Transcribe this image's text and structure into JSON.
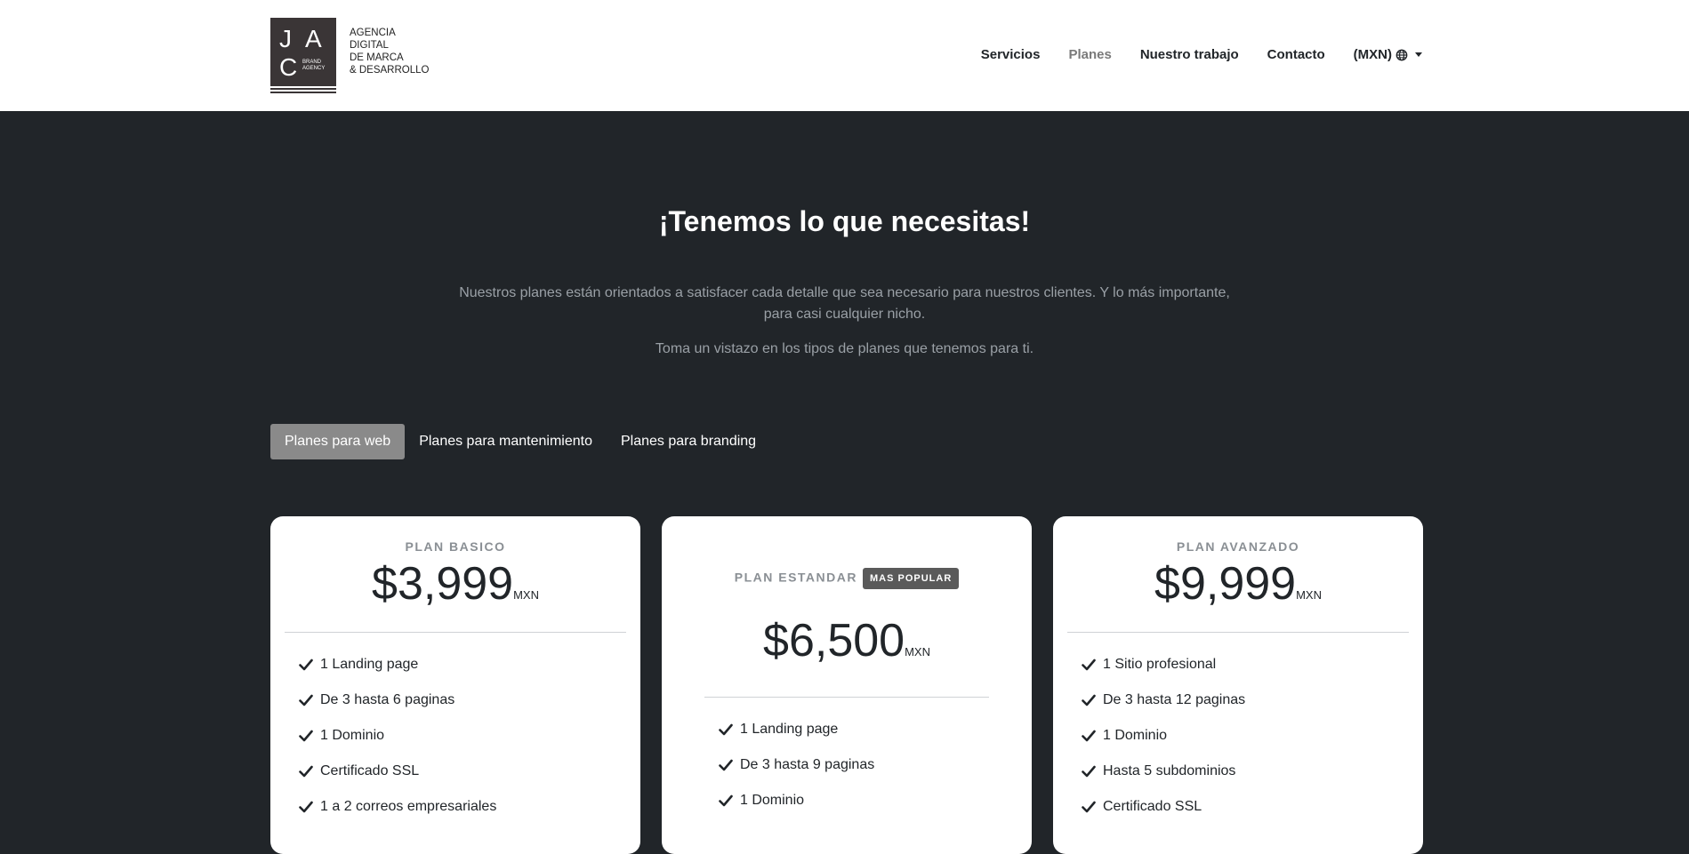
{
  "logo": {
    "letters": [
      "J",
      "A",
      "C"
    ],
    "small": "BRAND\nAGENCY",
    "text": "AGENCIA\nDIGITAL\nDE MARCA\n& DESARROLLO"
  },
  "nav": {
    "items": [
      {
        "label": "Servicios"
      },
      {
        "label": "Planes"
      },
      {
        "label": "Nuestro trabajo"
      },
      {
        "label": "Contacto"
      }
    ],
    "currency": "(MXN)",
    "icon": "globe-icon"
  },
  "hero": {
    "title": "¡Tenemos lo que necesitas!",
    "para1_line1": "Nuestros planes están orientados a satisfacer cada detalle que sea necesario para nuestros clientes. Y lo más importante,",
    "para1_line2": "para casi cualquier nicho.",
    "para2": "Toma un vistazo en los tipos de planes que tenemos para ti."
  },
  "tabs": [
    {
      "label": "Planes para web"
    },
    {
      "label": "Planes para mantenimiento"
    },
    {
      "label": "Planes para branding"
    }
  ],
  "plans": [
    {
      "name": "PLAN BASICO",
      "price": "$3,999",
      "currency": "MXN",
      "features": [
        "1 Landing page",
        "De 3 hasta 6 paginas",
        "1 Dominio",
        "Certificado SSL",
        "1 a 2 correos empresariales"
      ]
    },
    {
      "name": "PLAN ESTANDAR",
      "badge": "MAS POPULAR",
      "price": "$6,500",
      "currency": "MXN",
      "features": [
        "1 Landing page",
        "De 3 hasta 9 paginas",
        "1 Dominio"
      ]
    },
    {
      "name": "PLAN AVANZADO",
      "price": "$9,999",
      "currency": "MXN",
      "features": [
        "1 Sitio profesional",
        "De 3 hasta 12 paginas",
        "1 Dominio",
        "Hasta 5 subdominios",
        "Certificado SSL"
      ]
    }
  ],
  "colors": {
    "dark_bg": "#212529",
    "accent_gray": "#8a8a8a",
    "logo_dark": "#3a3536"
  }
}
